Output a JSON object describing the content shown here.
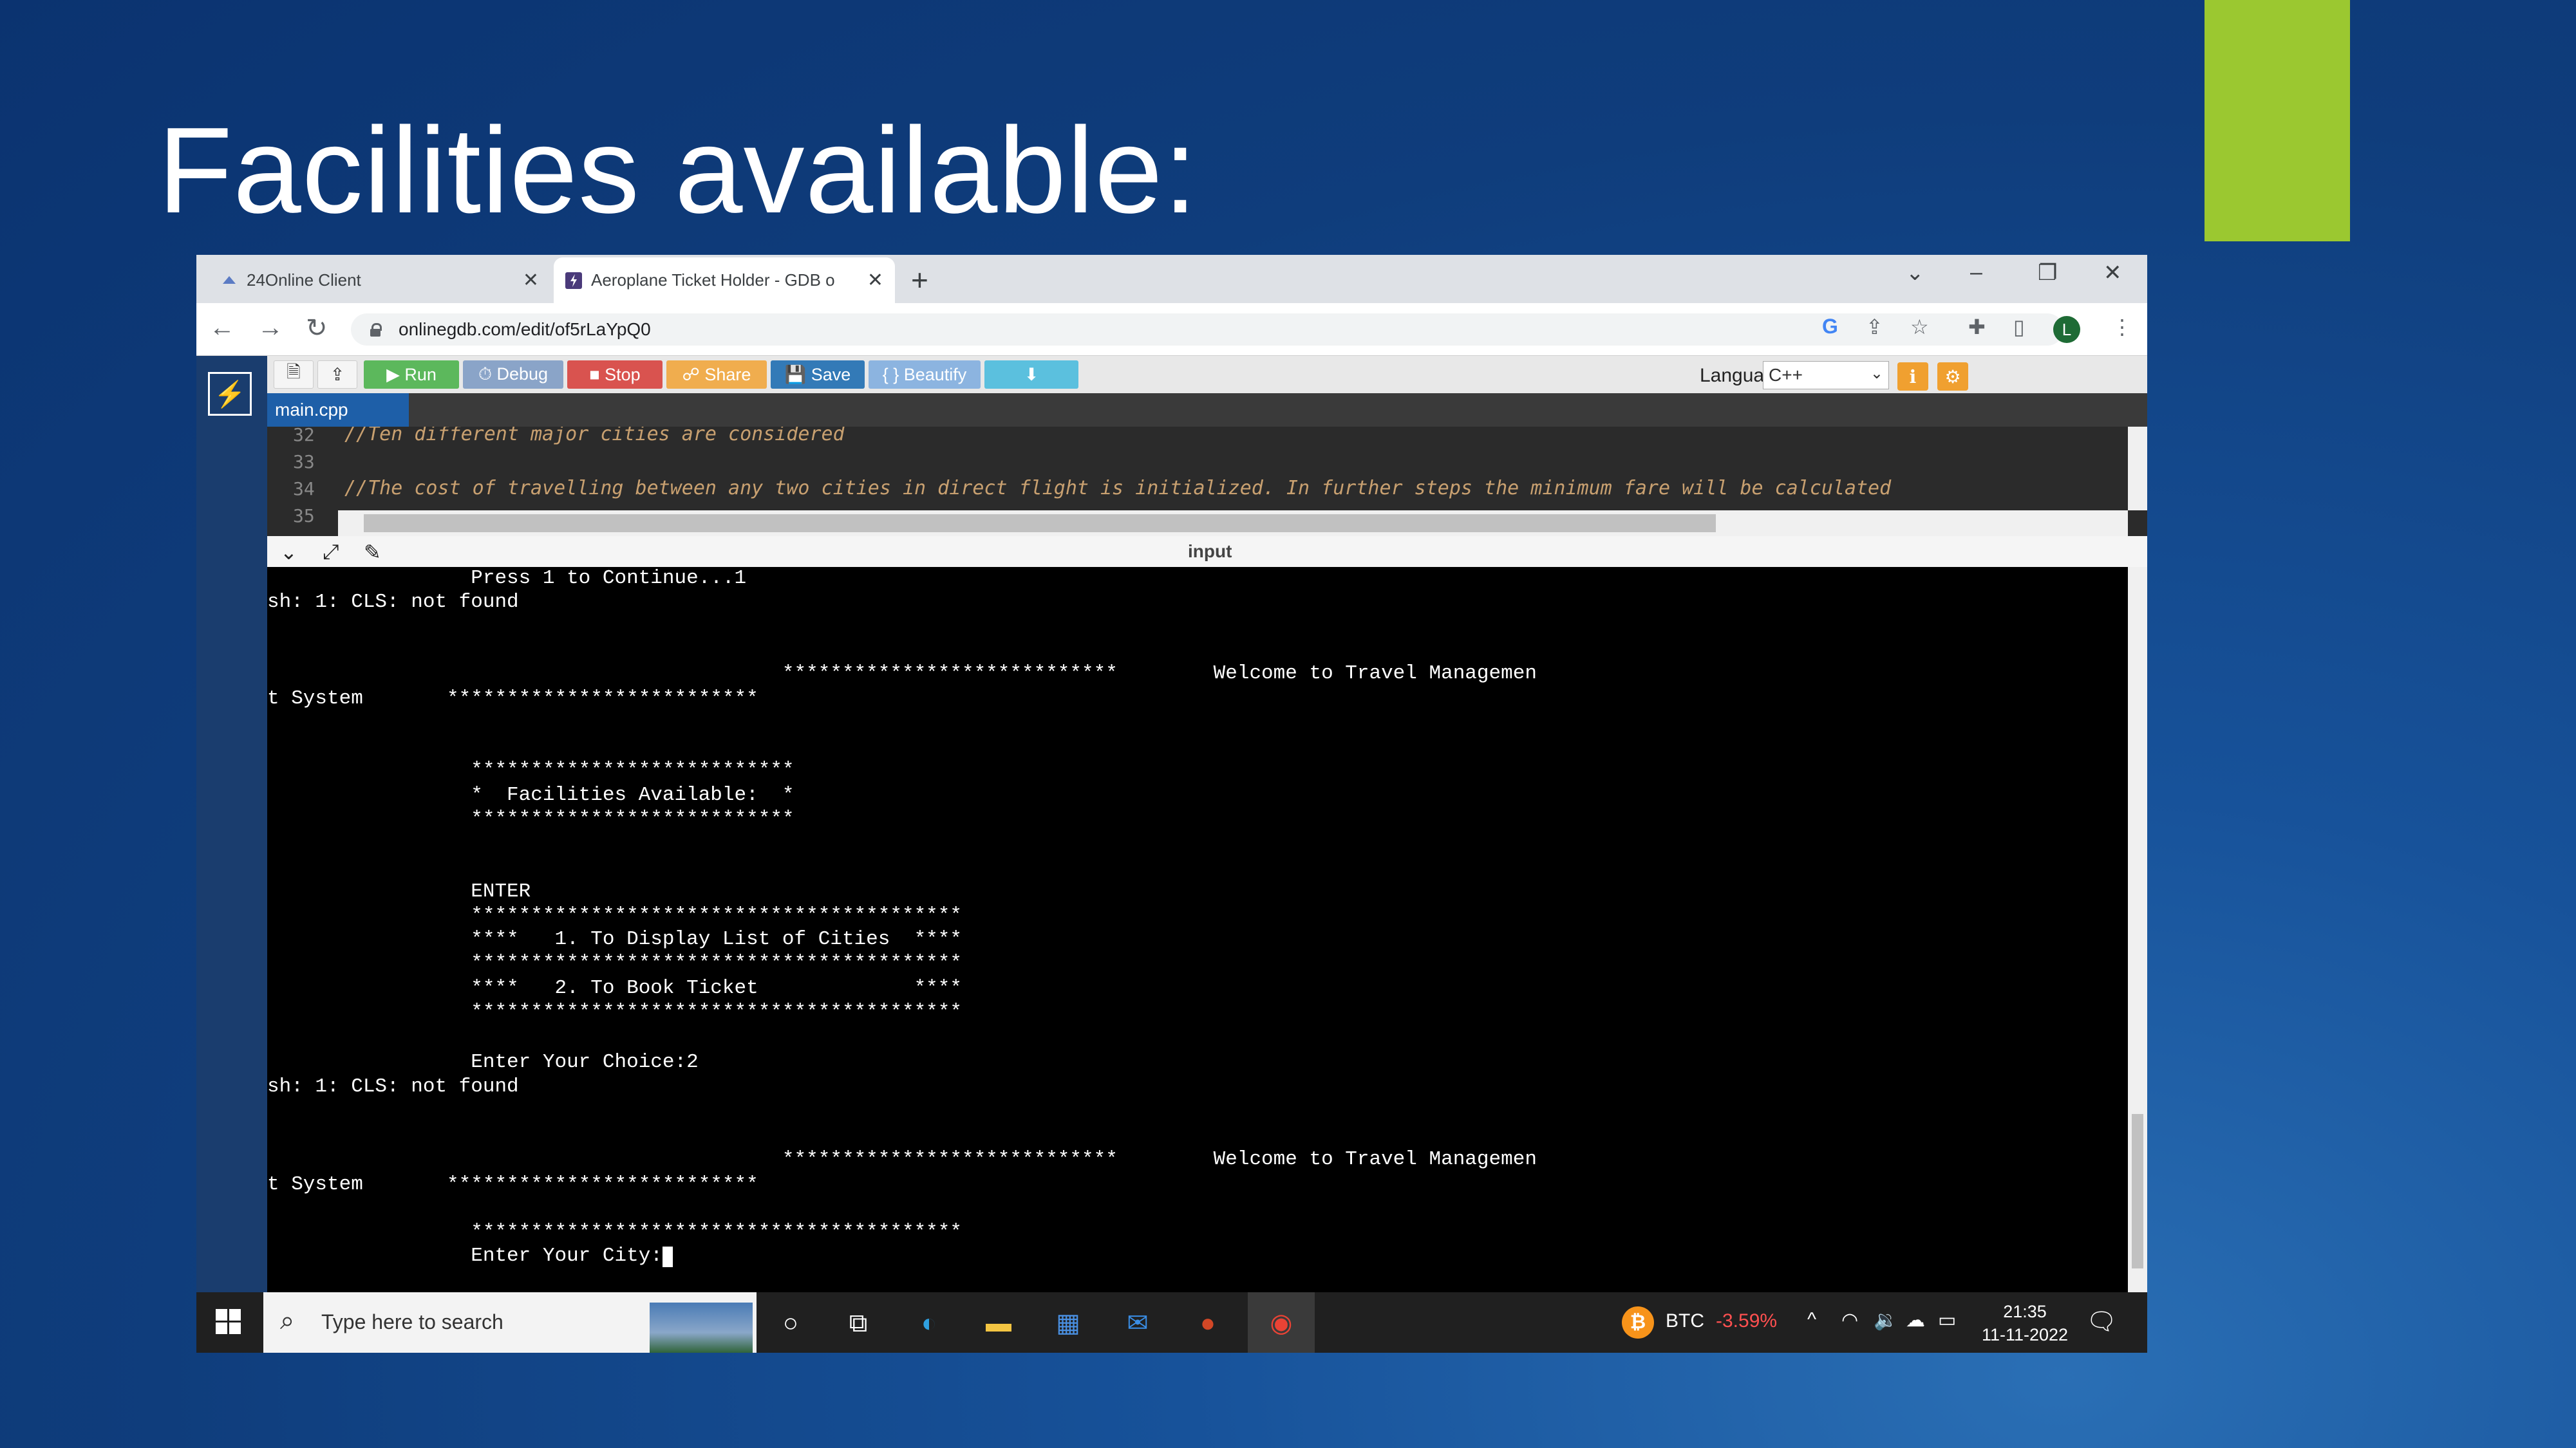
{
  "slide": {
    "title": "Facilities available:",
    "accent_color": "#9bc830"
  },
  "browser": {
    "tabs": [
      {
        "label": "24Online Client",
        "close": "✕",
        "favicon": "24online-icon"
      },
      {
        "label": "Aeroplane Ticket Holder - GDB o",
        "close": "✕",
        "favicon": "onlinegdb-icon"
      }
    ],
    "new_tab": "+",
    "url": "onlinegdb.com/edit/of5rLaYpQ0"
  },
  "gdb": {
    "toolbar": {
      "run": "▶ Run",
      "debug": "⏱ Debug",
      "stop": "■ Stop",
      "share": "☍ Share",
      "save": "💾 Save",
      "beautify": "{ } Beautify",
      "download": "⬇",
      "language_label": "Language",
      "language_value": "C++"
    },
    "file_tab": "main.cpp",
    "code_lines": [
      {
        "n": "32",
        "text": "//Ten different major cities are considered"
      },
      {
        "n": "33",
        "text": ""
      },
      {
        "n": "34",
        "text": "//The cost of travelling between any two cities in direct flight is initialized. In further steps the minimum fare will be calculated"
      },
      {
        "n": "35",
        "text": ""
      }
    ],
    "input_label": "input",
    "console_lines": [
      "                 Press 1 to Continue...1",
      "sh: 1: CLS: not found",
      "",
      "",
      "                                           ****************************        Welcome to Travel Managemen",
      "t System       **************************",
      "",
      "",
      "                 ***************************",
      "                 *  Facilities Available:  *",
      "                 ***************************",
      "",
      "",
      "                 ENTER",
      "                 *****************************************",
      "                 ****   1. To Display List of Cities  ****",
      "                 *****************************************",
      "                 ****   2. To Book Ticket             ****",
      "                 *****************************************",
      "",
      "                 Enter Your Choice:2",
      "sh: 1: CLS: not found",
      "",
      "",
      "                                           ****************************        Welcome to Travel Managemen",
      "t System       **************************",
      "",
      "                 *****************************************",
      "                 Enter Your City:"
    ]
  },
  "taskbar": {
    "search_placeholder": "Type here to search",
    "btc_label": "BTC",
    "btc_change": "-3.59%",
    "time": "21:35",
    "date": "11-11-2022",
    "profile_initial": "L"
  }
}
